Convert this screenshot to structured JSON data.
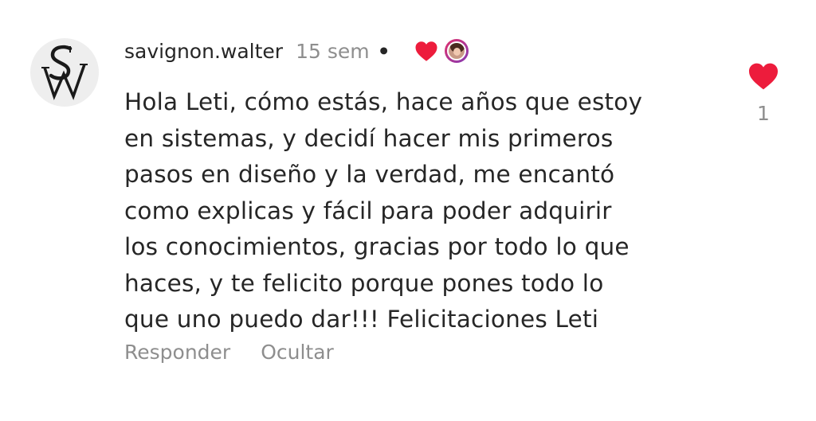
{
  "comment": {
    "avatar_monogram": "SW",
    "username": "savignon.walter",
    "time_ago": "15 sem",
    "separator": "•",
    "text_lines": [
      "Hola Leti, cómo estás, hace años que estoy",
      "en sistemas, y decidí hacer mis primeros",
      "pasos en diseño y la verdad, me encantó",
      "como explicas y fácil para poder adquirir",
      "los conocimientos, gracias por todo lo que",
      "haces, y te felicito porque pones todo lo",
      "que uno puedo dar!!! Felicitaciones Leti"
    ],
    "actions": {
      "reply_label": "Responder",
      "hide_label": "Ocultar"
    },
    "like": {
      "count": "1",
      "liked": true
    },
    "creator_liked": true
  },
  "colors": {
    "heart": "#ed1c3c",
    "text": "#262626",
    "secondary_text": "#8e8e8e"
  },
  "icons": {
    "creator_heart": "heart-icon",
    "like": "heart-icon"
  }
}
